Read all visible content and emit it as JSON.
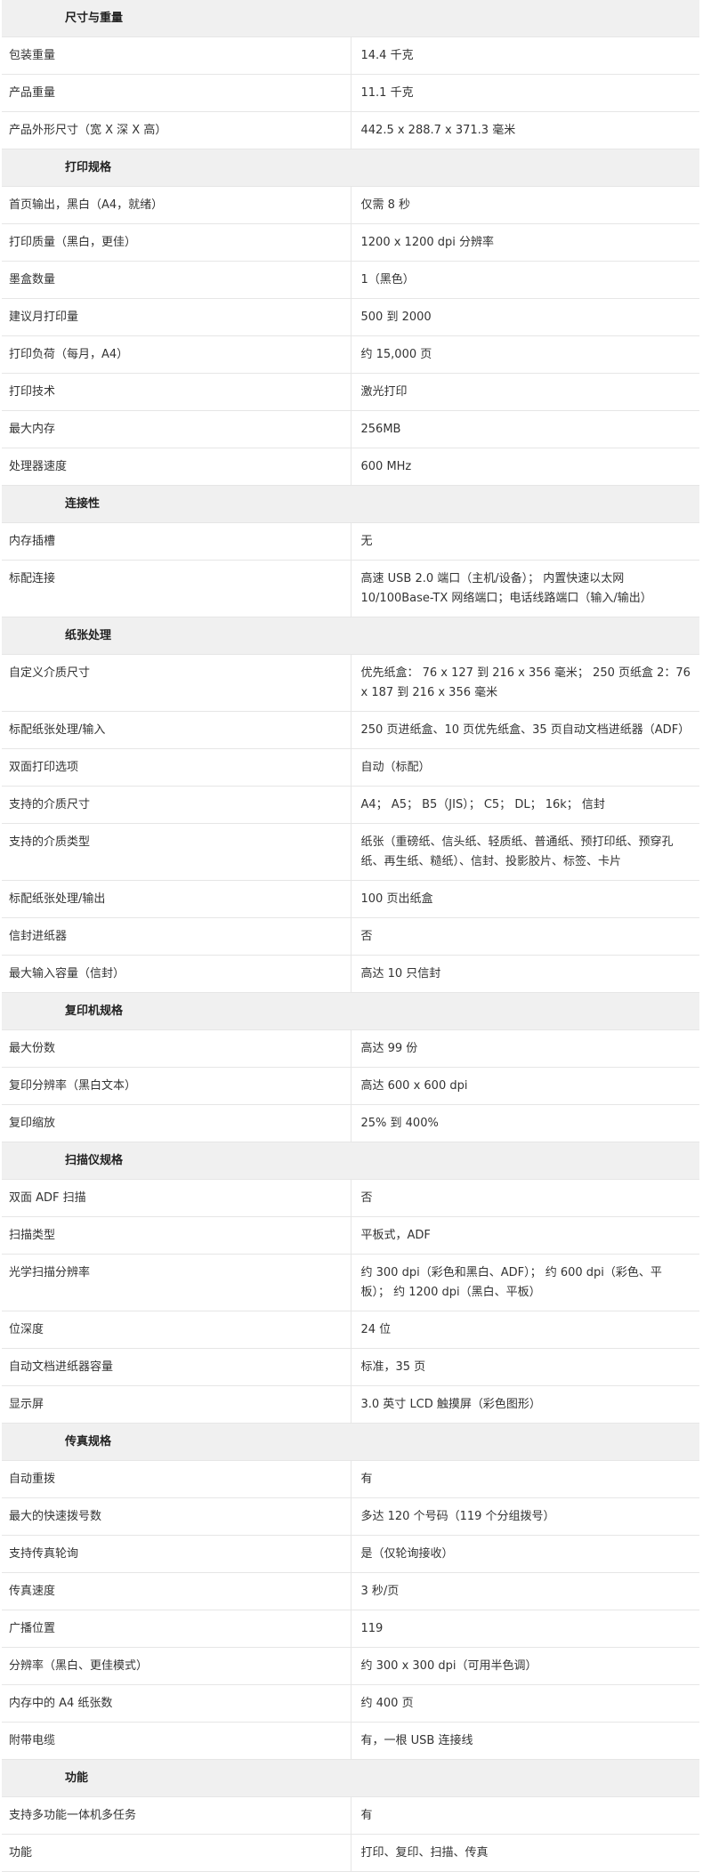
{
  "sections": [
    {
      "title": "尺寸与重量",
      "rows": [
        {
          "label": "包装重量",
          "value": "14.4 千克"
        },
        {
          "label": "产品重量",
          "value": "11.1 千克"
        },
        {
          "label": "产品外形尺寸（宽 X 深 X 高）",
          "value": "442.5 x 288.7 x 371.3 毫米"
        }
      ]
    },
    {
      "title": "打印规格",
      "rows": [
        {
          "label": "首页输出，黑白（A4，就绪）",
          "value": "仅需 8 秒"
        },
        {
          "label": "打印质量（黑白，更佳）",
          "value": "1200 x 1200 dpi 分辨率"
        },
        {
          "label": "墨盒数量",
          "value": "1（黑色）"
        },
        {
          "label": "建议月打印量",
          "value": "500 到 2000"
        },
        {
          "label": "打印负荷（每月，A4）",
          "value": "约 15,000 页"
        },
        {
          "label": "打印技术",
          "value": "激光打印"
        },
        {
          "label": "最大内存",
          "value": "256MB"
        },
        {
          "label": "处理器速度",
          "value": "600 MHz"
        }
      ]
    },
    {
      "title": "连接性",
      "rows": [
        {
          "label": "内存插槽",
          "value": "无"
        },
        {
          "label": "标配连接",
          "value": "高速 USB 2.0 端口（主机/设备）； 内置快速以太网 10/100Base-TX 网络端口；电话线路端口（输入/输出）"
        }
      ]
    },
    {
      "title": "纸张处理",
      "rows": [
        {
          "label": "自定义介质尺寸",
          "value": "优先纸盒： 76 x 127 到 216 x 356 毫米； 250 页纸盒 2：76 x 187 到 216 x 356 毫米"
        },
        {
          "label": "标配纸张处理/输入",
          "value": "250 页进纸盒、10 页优先纸盒、35 页自动文档进纸器（ADF）"
        },
        {
          "label": "双面打印选项",
          "value": "自动（标配）"
        },
        {
          "label": "支持的介质尺寸",
          "value": "A4； A5； B5（JIS）； C5； DL； 16k； 信封"
        },
        {
          "label": "支持的介质类型",
          "value": "纸张（重磅纸、信头纸、轻质纸、普通纸、预打印纸、预穿孔纸、再生纸、糙纸）、信封、投影胶片、标签、卡片"
        },
        {
          "label": "标配纸张处理/输出",
          "value": "100 页出纸盒"
        },
        {
          "label": "信封进纸器",
          "value": "否"
        },
        {
          "label": "最大输入容量（信封）",
          "value": "高达 10 只信封"
        }
      ]
    },
    {
      "title": "复印机规格",
      "rows": [
        {
          "label": "最大份数",
          "value": "高达 99 份"
        },
        {
          "label": "复印分辨率（黑白文本）",
          "value": "高达 600 x 600 dpi"
        },
        {
          "label": "复印缩放",
          "value": "25% 到 400%"
        }
      ]
    },
    {
      "title": "扫描仪规格",
      "rows": [
        {
          "label": "双面 ADF 扫描",
          "value": "否"
        },
        {
          "label": "扫描类型",
          "value": "平板式，ADF"
        },
        {
          "label": "光学扫描分辨率",
          "value": "约 300 dpi（彩色和黑白、ADF）； 约 600 dpi（彩色、平板）； 约 1200 dpi（黑白、平板）"
        },
        {
          "label": "位深度",
          "value": "24 位"
        },
        {
          "label": "自动文档进纸器容量",
          "value": "标准，35 页"
        },
        {
          "label": "显示屏",
          "value": "3.0 英寸 LCD 触摸屏（彩色图形）"
        }
      ]
    },
    {
      "title": "传真规格",
      "rows": [
        {
          "label": "自动重拨",
          "value": "有"
        },
        {
          "label": "最大的快速拨号数",
          "value": "多达 120 个号码（119 个分组拨号）"
        },
        {
          "label": "支持传真轮询",
          "value": "是（仅轮询接收）"
        },
        {
          "label": "传真速度",
          "value": "3 秒/页"
        },
        {
          "label": "广播位置",
          "value": "119"
        },
        {
          "label": "分辨率（黑白、更佳模式）",
          "value": "约 300 x 300 dpi（可用半色调）"
        },
        {
          "label": "内存中的 A4 纸张数",
          "value": "约 400 页"
        },
        {
          "label": "附带电缆",
          "value": "有，一根 USB 连接线"
        }
      ]
    },
    {
      "title": "功能",
      "rows": [
        {
          "label": "支持多功能一体机多任务",
          "value": "有"
        },
        {
          "label": "功能",
          "value": "打印、复印、扫描、传真"
        }
      ]
    }
  ]
}
